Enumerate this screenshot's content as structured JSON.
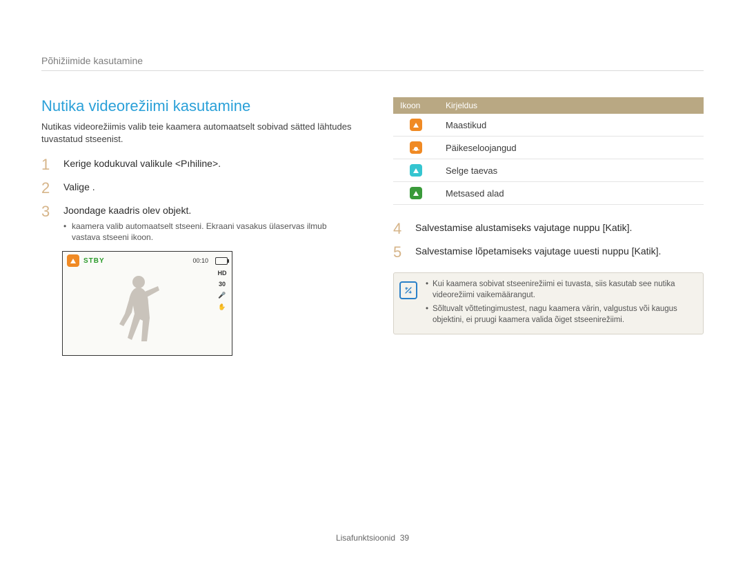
{
  "breadcrumb": "Põhižiimide kasutamine",
  "title": "Nutika videorežiimi kasutamine",
  "intro": "Nutikas videorežiimis valib teie kaamera automaatselt sobivad sätted lähtudes tuvastatud stseenist.",
  "steps": {
    "s1": {
      "num": "1",
      "text": "Kerige kodukuval valikule <Pıhiline>."
    },
    "s2": {
      "num": "2",
      "text": "Valige       ."
    },
    "s3": {
      "num": "3",
      "text": "Joondage kaadris olev objekt.",
      "sub": "kaamera valib automaatselt stseeni. Ekraani vasakus ülaservas ilmub vastava stseeni ikoon."
    },
    "s4": {
      "num": "4",
      "text": "Salvestamise alustamiseks vajutage nuppu [Katik]."
    },
    "s5": {
      "num": "5",
      "text": "Salvestamise lõpetamiseks vajutage uuesti nuppu [Katik]."
    }
  },
  "screen": {
    "status": "STBY",
    "timer": "00:10",
    "indicators": [
      "HD",
      "30",
      "🎤",
      "✋"
    ]
  },
  "table": {
    "headers": {
      "icon": "Ikoon",
      "desc": "Kirjeldus"
    },
    "rows": [
      {
        "icon": "landscapes",
        "desc": "Maastikud"
      },
      {
        "icon": "sunsets",
        "desc": "Päikeseloojangud"
      },
      {
        "icon": "clear-sky",
        "desc": "Selge taevas"
      },
      {
        "icon": "forest",
        "desc": "Metsased alad"
      }
    ]
  },
  "notes": [
    "Kui kaamera sobivat stseenirežiimi ei tuvasta, siis kasutab see nutika videorežiimi vaikemäärangut.",
    "Sõltuvalt võttetingimustest, nagu kaamera värin, valgustus või kaugus objektini, ei pruugi kaamera valida õiget stseenirežiimi."
  ],
  "footer": {
    "section": "Lisafunktsioonid",
    "page": "39"
  }
}
